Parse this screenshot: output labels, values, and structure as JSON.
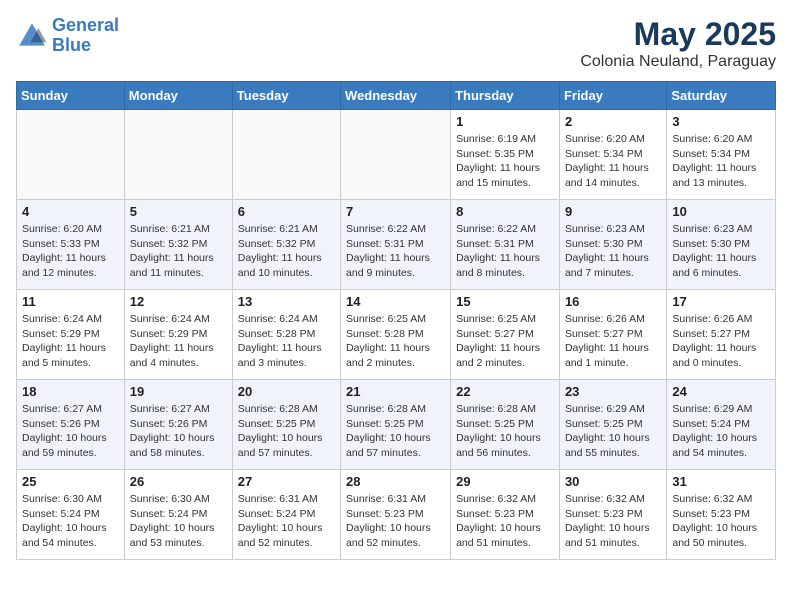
{
  "header": {
    "logo_line1": "General",
    "logo_line2": "Blue",
    "month": "May 2025",
    "location": "Colonia Neuland, Paraguay"
  },
  "weekdays": [
    "Sunday",
    "Monday",
    "Tuesday",
    "Wednesday",
    "Thursday",
    "Friday",
    "Saturday"
  ],
  "weeks": [
    [
      {
        "day": "",
        "info": ""
      },
      {
        "day": "",
        "info": ""
      },
      {
        "day": "",
        "info": ""
      },
      {
        "day": "",
        "info": ""
      },
      {
        "day": "1",
        "info": "Sunrise: 6:19 AM\nSunset: 5:35 PM\nDaylight: 11 hours\nand 15 minutes."
      },
      {
        "day": "2",
        "info": "Sunrise: 6:20 AM\nSunset: 5:34 PM\nDaylight: 11 hours\nand 14 minutes."
      },
      {
        "day": "3",
        "info": "Sunrise: 6:20 AM\nSunset: 5:34 PM\nDaylight: 11 hours\nand 13 minutes."
      }
    ],
    [
      {
        "day": "4",
        "info": "Sunrise: 6:20 AM\nSunset: 5:33 PM\nDaylight: 11 hours\nand 12 minutes."
      },
      {
        "day": "5",
        "info": "Sunrise: 6:21 AM\nSunset: 5:32 PM\nDaylight: 11 hours\nand 11 minutes."
      },
      {
        "day": "6",
        "info": "Sunrise: 6:21 AM\nSunset: 5:32 PM\nDaylight: 11 hours\nand 10 minutes."
      },
      {
        "day": "7",
        "info": "Sunrise: 6:22 AM\nSunset: 5:31 PM\nDaylight: 11 hours\nand 9 minutes."
      },
      {
        "day": "8",
        "info": "Sunrise: 6:22 AM\nSunset: 5:31 PM\nDaylight: 11 hours\nand 8 minutes."
      },
      {
        "day": "9",
        "info": "Sunrise: 6:23 AM\nSunset: 5:30 PM\nDaylight: 11 hours\nand 7 minutes."
      },
      {
        "day": "10",
        "info": "Sunrise: 6:23 AM\nSunset: 5:30 PM\nDaylight: 11 hours\nand 6 minutes."
      }
    ],
    [
      {
        "day": "11",
        "info": "Sunrise: 6:24 AM\nSunset: 5:29 PM\nDaylight: 11 hours\nand 5 minutes."
      },
      {
        "day": "12",
        "info": "Sunrise: 6:24 AM\nSunset: 5:29 PM\nDaylight: 11 hours\nand 4 minutes."
      },
      {
        "day": "13",
        "info": "Sunrise: 6:24 AM\nSunset: 5:28 PM\nDaylight: 11 hours\nand 3 minutes."
      },
      {
        "day": "14",
        "info": "Sunrise: 6:25 AM\nSunset: 5:28 PM\nDaylight: 11 hours\nand 2 minutes."
      },
      {
        "day": "15",
        "info": "Sunrise: 6:25 AM\nSunset: 5:27 PM\nDaylight: 11 hours\nand 2 minutes."
      },
      {
        "day": "16",
        "info": "Sunrise: 6:26 AM\nSunset: 5:27 PM\nDaylight: 11 hours\nand 1 minute."
      },
      {
        "day": "17",
        "info": "Sunrise: 6:26 AM\nSunset: 5:27 PM\nDaylight: 11 hours\nand 0 minutes."
      }
    ],
    [
      {
        "day": "18",
        "info": "Sunrise: 6:27 AM\nSunset: 5:26 PM\nDaylight: 10 hours\nand 59 minutes."
      },
      {
        "day": "19",
        "info": "Sunrise: 6:27 AM\nSunset: 5:26 PM\nDaylight: 10 hours\nand 58 minutes."
      },
      {
        "day": "20",
        "info": "Sunrise: 6:28 AM\nSunset: 5:25 PM\nDaylight: 10 hours\nand 57 minutes."
      },
      {
        "day": "21",
        "info": "Sunrise: 6:28 AM\nSunset: 5:25 PM\nDaylight: 10 hours\nand 57 minutes."
      },
      {
        "day": "22",
        "info": "Sunrise: 6:28 AM\nSunset: 5:25 PM\nDaylight: 10 hours\nand 56 minutes."
      },
      {
        "day": "23",
        "info": "Sunrise: 6:29 AM\nSunset: 5:25 PM\nDaylight: 10 hours\nand 55 minutes."
      },
      {
        "day": "24",
        "info": "Sunrise: 6:29 AM\nSunset: 5:24 PM\nDaylight: 10 hours\nand 54 minutes."
      }
    ],
    [
      {
        "day": "25",
        "info": "Sunrise: 6:30 AM\nSunset: 5:24 PM\nDaylight: 10 hours\nand 54 minutes."
      },
      {
        "day": "26",
        "info": "Sunrise: 6:30 AM\nSunset: 5:24 PM\nDaylight: 10 hours\nand 53 minutes."
      },
      {
        "day": "27",
        "info": "Sunrise: 6:31 AM\nSunset: 5:24 PM\nDaylight: 10 hours\nand 52 minutes."
      },
      {
        "day": "28",
        "info": "Sunrise: 6:31 AM\nSunset: 5:23 PM\nDaylight: 10 hours\nand 52 minutes."
      },
      {
        "day": "29",
        "info": "Sunrise: 6:32 AM\nSunset: 5:23 PM\nDaylight: 10 hours\nand 51 minutes."
      },
      {
        "day": "30",
        "info": "Sunrise: 6:32 AM\nSunset: 5:23 PM\nDaylight: 10 hours\nand 51 minutes."
      },
      {
        "day": "31",
        "info": "Sunrise: 6:32 AM\nSunset: 5:23 PM\nDaylight: 10 hours\nand 50 minutes."
      }
    ]
  ]
}
